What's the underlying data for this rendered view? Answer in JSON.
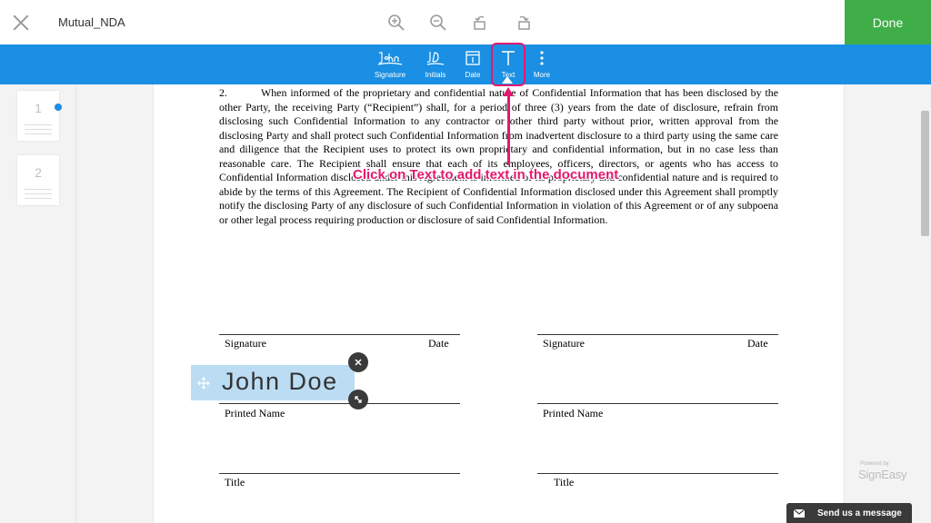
{
  "header": {
    "doc_title": "Mutual_NDA",
    "done_label": "Done",
    "tools": [
      "zoom-in-icon",
      "zoom-out-icon",
      "rotate-left-icon",
      "rotate-right-icon"
    ]
  },
  "toolbar": {
    "items": [
      {
        "label": "Signature",
        "glyph": "John",
        "icon": "signature-icon"
      },
      {
        "label": "Initials",
        "glyph": "JD",
        "icon": "initials-icon"
      },
      {
        "label": "Date",
        "glyph": "1",
        "icon": "calendar-icon"
      },
      {
        "label": "Text",
        "glyph": "T",
        "icon": "text-icon"
      },
      {
        "label": "More",
        "icon": "more-vertical-icon"
      }
    ]
  },
  "sidebar": {
    "pages": [
      {
        "number": "1",
        "selected": true
      },
      {
        "number": "2",
        "selected": false
      }
    ]
  },
  "document": {
    "paragraph_number": "2.",
    "paragraph_text": "When informed of the proprietary and confidential nature of Confidential Information that has been disclosed by the other Party, the receiving Party (“Recipient”) shall, for a period of three (3) years from the date of disclosure, refrain from disclosing such Confidential Information to any contractor or other third party without prior, written approval from the disclosing Party and shall protect such Confidential Information from inadvertent disclosure to a third party using the same care and diligence that the Recipient uses to protect its own proprietary and confidential information, but in no case less than reasonable care. The Recipient shall ensure that each of its employees, officers, directors, or agents who has access to Confidential Information disclosed under this Agreement is informed of its proprietary and confidential nature and is required to abide by the terms of this Agreement. The Recipient of Confidential Information disclosed under this Agreement shall promptly notify the disclosing Party of any disclosure of such Confidential Information in violation of this Agreement or of any subpoena or other legal process requiring production or disclosure of said Confidential Information.",
    "signature_label": "Signature",
    "date_label": "Date",
    "printed_name_label": "Printed Name",
    "title_label": "Title"
  },
  "text_field": {
    "value": "John Doe"
  },
  "annotation": {
    "text": "Click on Text to add text in the document",
    "color": "#e3186f"
  },
  "branding": {
    "powered_by": "Powered by",
    "name": "SignEasy"
  },
  "message": {
    "label": "Send us a message"
  },
  "colors": {
    "toolbar_blue": "#1a8fe3",
    "done_green": "#3fae49",
    "highlight_pink": "#e3186f"
  }
}
